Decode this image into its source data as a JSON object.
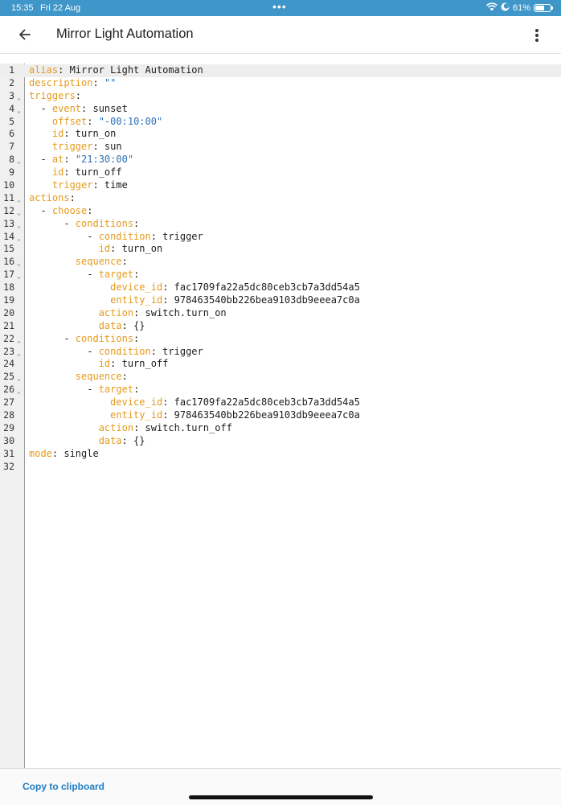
{
  "status_bar": {
    "time": "15:35",
    "date": "Fri 22 Aug",
    "dots": "•••",
    "battery": "61%",
    "battery_level": 0.61,
    "icons": [
      "wifi-icon",
      "focus-moon-icon",
      "battery-icon"
    ]
  },
  "header": {
    "title": "Mirror Light Automation",
    "back_icon": "arrow-left-icon",
    "menu_icon": "more-vertical-icon"
  },
  "editor": {
    "language": "yaml",
    "colors": {
      "key": "#e59a1c",
      "string": "#2a72b5",
      "text": "#1d1d1d"
    },
    "lines": [
      {
        "n": "1",
        "fold": false,
        "parts": [
          [
            "k",
            "alias"
          ],
          [
            "t",
            ": Mirror Light Automation"
          ]
        ]
      },
      {
        "n": "2",
        "fold": false,
        "parts": [
          [
            "k",
            "description"
          ],
          [
            "t",
            ": "
          ],
          [
            "s",
            "\"\""
          ]
        ]
      },
      {
        "n": "3",
        "fold": true,
        "parts": [
          [
            "k",
            "triggers"
          ],
          [
            "t",
            ":"
          ]
        ]
      },
      {
        "n": "4",
        "fold": true,
        "parts": [
          [
            "t",
            "  - "
          ],
          [
            "k",
            "event"
          ],
          [
            "t",
            ": sunset"
          ]
        ]
      },
      {
        "n": "5",
        "fold": false,
        "parts": [
          [
            "t",
            "    "
          ],
          [
            "k",
            "offset"
          ],
          [
            "t",
            ": "
          ],
          [
            "s",
            "\"-00:10:00\""
          ]
        ]
      },
      {
        "n": "6",
        "fold": false,
        "parts": [
          [
            "t",
            "    "
          ],
          [
            "k",
            "id"
          ],
          [
            "t",
            ": turn_on"
          ]
        ]
      },
      {
        "n": "7",
        "fold": false,
        "parts": [
          [
            "t",
            "    "
          ],
          [
            "k",
            "trigger"
          ],
          [
            "t",
            ": sun"
          ]
        ]
      },
      {
        "n": "8",
        "fold": true,
        "parts": [
          [
            "t",
            "  - "
          ],
          [
            "k",
            "at"
          ],
          [
            "t",
            ": "
          ],
          [
            "s",
            "\"21:30:00\""
          ]
        ]
      },
      {
        "n": "9",
        "fold": false,
        "parts": [
          [
            "t",
            "    "
          ],
          [
            "k",
            "id"
          ],
          [
            "t",
            ": turn_off"
          ]
        ]
      },
      {
        "n": "10",
        "fold": false,
        "parts": [
          [
            "t",
            "    "
          ],
          [
            "k",
            "trigger"
          ],
          [
            "t",
            ": time"
          ]
        ]
      },
      {
        "n": "11",
        "fold": true,
        "parts": [
          [
            "k",
            "actions"
          ],
          [
            "t",
            ":"
          ]
        ]
      },
      {
        "n": "12",
        "fold": true,
        "parts": [
          [
            "t",
            "  - "
          ],
          [
            "k",
            "choose"
          ],
          [
            "t",
            ":"
          ]
        ]
      },
      {
        "n": "13",
        "fold": true,
        "parts": [
          [
            "t",
            "      - "
          ],
          [
            "k",
            "conditions"
          ],
          [
            "t",
            ":"
          ]
        ]
      },
      {
        "n": "14",
        "fold": true,
        "parts": [
          [
            "t",
            "          - "
          ],
          [
            "k",
            "condition"
          ],
          [
            "t",
            ": trigger"
          ]
        ]
      },
      {
        "n": "15",
        "fold": false,
        "parts": [
          [
            "t",
            "            "
          ],
          [
            "k",
            "id"
          ],
          [
            "t",
            ": turn_on"
          ]
        ]
      },
      {
        "n": "16",
        "fold": true,
        "parts": [
          [
            "t",
            "        "
          ],
          [
            "k",
            "sequence"
          ],
          [
            "t",
            ":"
          ]
        ]
      },
      {
        "n": "17",
        "fold": true,
        "parts": [
          [
            "t",
            "          - "
          ],
          [
            "k",
            "target"
          ],
          [
            "t",
            ":"
          ]
        ]
      },
      {
        "n": "18",
        "fold": false,
        "parts": [
          [
            "t",
            "              "
          ],
          [
            "k",
            "device_id"
          ],
          [
            "t",
            ": fac1709fa22a5dc80ceb3cb7a3dd54a5"
          ]
        ]
      },
      {
        "n": "19",
        "fold": false,
        "parts": [
          [
            "t",
            "              "
          ],
          [
            "k",
            "entity_id"
          ],
          [
            "t",
            ": 978463540bb226bea9103db9eeea7c0a"
          ]
        ]
      },
      {
        "n": "20",
        "fold": false,
        "parts": [
          [
            "t",
            "            "
          ],
          [
            "k",
            "action"
          ],
          [
            "t",
            ": switch.turn_on"
          ]
        ]
      },
      {
        "n": "21",
        "fold": false,
        "parts": [
          [
            "t",
            "            "
          ],
          [
            "k",
            "data"
          ],
          [
            "t",
            ": {}"
          ]
        ]
      },
      {
        "n": "22",
        "fold": true,
        "parts": [
          [
            "t",
            "      - "
          ],
          [
            "k",
            "conditions"
          ],
          [
            "t",
            ":"
          ]
        ]
      },
      {
        "n": "23",
        "fold": true,
        "parts": [
          [
            "t",
            "          - "
          ],
          [
            "k",
            "condition"
          ],
          [
            "t",
            ": trigger"
          ]
        ]
      },
      {
        "n": "24",
        "fold": false,
        "parts": [
          [
            "t",
            "            "
          ],
          [
            "k",
            "id"
          ],
          [
            "t",
            ": turn_off"
          ]
        ]
      },
      {
        "n": "25",
        "fold": true,
        "parts": [
          [
            "t",
            "        "
          ],
          [
            "k",
            "sequence"
          ],
          [
            "t",
            ":"
          ]
        ]
      },
      {
        "n": "26",
        "fold": true,
        "parts": [
          [
            "t",
            "          - "
          ],
          [
            "k",
            "target"
          ],
          [
            "t",
            ":"
          ]
        ]
      },
      {
        "n": "27",
        "fold": false,
        "parts": [
          [
            "t",
            "              "
          ],
          [
            "k",
            "device_id"
          ],
          [
            "t",
            ": fac1709fa22a5dc80ceb3cb7a3dd54a5"
          ]
        ]
      },
      {
        "n": "28",
        "fold": false,
        "parts": [
          [
            "t",
            "              "
          ],
          [
            "k",
            "entity_id"
          ],
          [
            "t",
            ": 978463540bb226bea9103db9eeea7c0a"
          ]
        ]
      },
      {
        "n": "29",
        "fold": false,
        "parts": [
          [
            "t",
            "            "
          ],
          [
            "k",
            "action"
          ],
          [
            "t",
            ": switch.turn_off"
          ]
        ]
      },
      {
        "n": "30",
        "fold": false,
        "parts": [
          [
            "t",
            "            "
          ],
          [
            "k",
            "data"
          ],
          [
            "t",
            ": {}"
          ]
        ]
      },
      {
        "n": "31",
        "fold": false,
        "parts": [
          [
            "k",
            "mode"
          ],
          [
            "t",
            ": single"
          ]
        ]
      },
      {
        "n": "32",
        "fold": false,
        "parts": []
      }
    ]
  },
  "footer": {
    "copy_label": "Copy to clipboard"
  }
}
